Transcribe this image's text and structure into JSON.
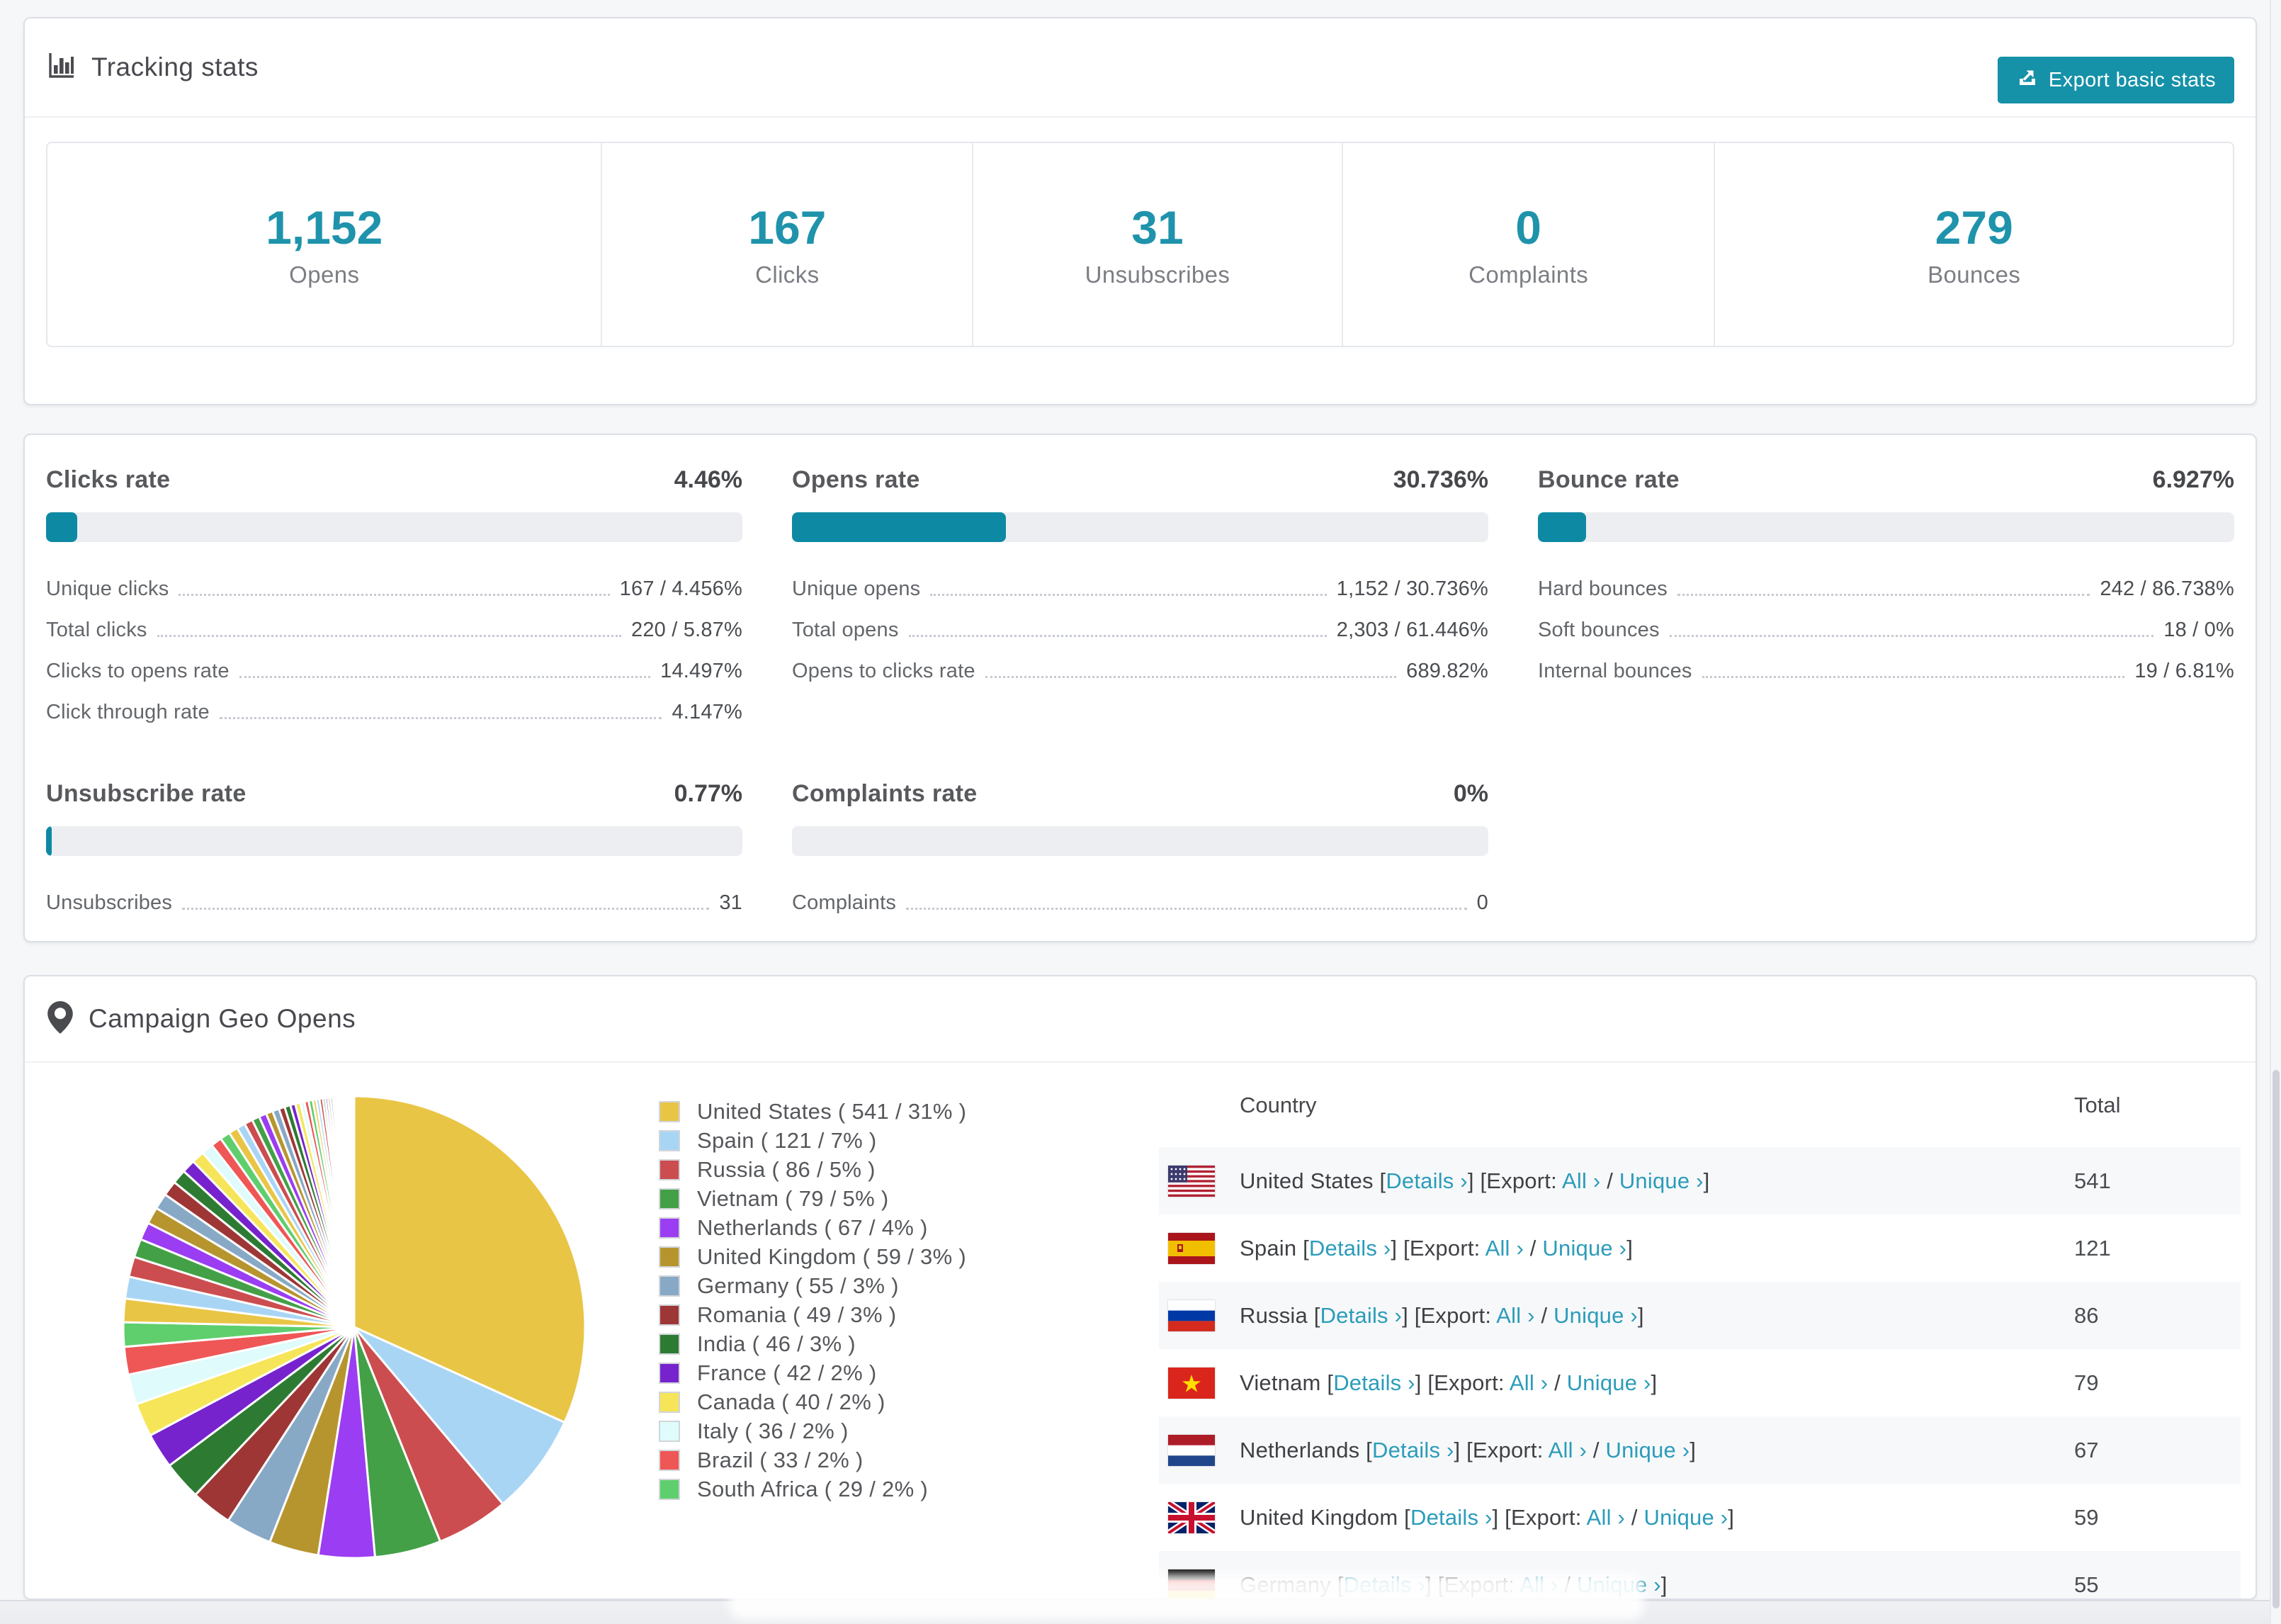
{
  "tracking": {
    "title": "Tracking stats",
    "export_button": "Export basic stats",
    "stats": [
      {
        "value": "1,152",
        "label": "Opens"
      },
      {
        "value": "167",
        "label": "Clicks"
      },
      {
        "value": "31",
        "label": "Unsubscribes"
      },
      {
        "value": "0",
        "label": "Complaints"
      },
      {
        "value": "279",
        "label": "Bounces"
      }
    ]
  },
  "rates": [
    {
      "title": "Clicks rate",
      "value": "4.46%",
      "percent": 4.46,
      "rows": [
        {
          "label": "Unique clicks",
          "value": "167 / 4.456%"
        },
        {
          "label": "Total clicks",
          "value": "220 / 5.87%"
        },
        {
          "label": "Clicks to opens rate",
          "value": "14.497%"
        },
        {
          "label": "Click through rate",
          "value": "4.147%"
        }
      ]
    },
    {
      "title": "Opens rate",
      "value": "30.736%",
      "percent": 30.736,
      "rows": [
        {
          "label": "Unique opens",
          "value": "1,152 / 30.736%"
        },
        {
          "label": "Total opens",
          "value": "2,303 / 61.446%"
        },
        {
          "label": "Opens to clicks rate",
          "value": "689.82%"
        }
      ]
    },
    {
      "title": "Bounce rate",
      "value": "6.927%",
      "percent": 6.927,
      "rows": [
        {
          "label": "Hard bounces",
          "value": "242 / 86.738%"
        },
        {
          "label": "Soft bounces",
          "value": "18 / 0%"
        },
        {
          "label": "Internal bounces",
          "value": "19 / 6.81%"
        }
      ]
    },
    {
      "title": "Unsubscribe rate",
      "value": "0.77%",
      "percent": 0.77,
      "rows": [
        {
          "label": "Unsubscribes",
          "value": "31"
        }
      ]
    },
    {
      "title": "Complaints rate",
      "value": "0%",
      "percent": 0,
      "rows": [
        {
          "label": "Complaints",
          "value": "0"
        }
      ]
    }
  ],
  "geo": {
    "title": "Campaign Geo Opens",
    "chart_data": {
      "type": "pie",
      "title": "Campaign Geo Opens",
      "start_angle_deg": -90,
      "direction": "clockwise",
      "slices": [
        {
          "label": "United States",
          "value": 541,
          "pct": "31%",
          "color": "#e9c545"
        },
        {
          "label": "Spain",
          "value": 121,
          "pct": "7%",
          "color": "#a9d5f5"
        },
        {
          "label": "Russia",
          "value": 86,
          "pct": "5%",
          "color": "#cc4d4f"
        },
        {
          "label": "Vietnam",
          "value": 79,
          "pct": "5%",
          "color": "#43a047"
        },
        {
          "label": "Netherlands",
          "value": 67,
          "pct": "4%",
          "color": "#9b3df2"
        },
        {
          "label": "United Kingdom",
          "value": 59,
          "pct": "3%",
          "color": "#b7952e"
        },
        {
          "label": "Germany",
          "value": 55,
          "pct": "3%",
          "color": "#88a9c6"
        },
        {
          "label": "Romania",
          "value": 49,
          "pct": "3%",
          "color": "#9e3636"
        },
        {
          "label": "India",
          "value": 46,
          "pct": "3%",
          "color": "#2d7b33"
        },
        {
          "label": "France",
          "value": 42,
          "pct": "2%",
          "color": "#7723cd"
        },
        {
          "label": "Canada",
          "value": 40,
          "pct": "2%",
          "color": "#f6e558"
        },
        {
          "label": "Italy",
          "value": 36,
          "pct": "2%",
          "color": "#dffbfb"
        },
        {
          "label": "Brazil",
          "value": 33,
          "pct": "2%",
          "color": "#ef5656"
        },
        {
          "label": "South Africa",
          "value": 29,
          "pct": "2%",
          "color": "#5fce6d"
        }
      ],
      "tail_values": [
        28,
        26,
        24,
        22,
        21,
        20,
        19,
        18,
        17,
        16,
        15,
        14,
        13,
        12,
        11,
        10,
        10,
        9,
        9,
        8,
        8,
        7,
        7,
        6,
        6,
        5,
        5,
        5,
        4,
        4,
        4,
        3,
        3,
        3,
        3,
        2,
        2,
        2,
        2,
        2,
        2,
        1,
        1,
        1,
        1,
        1,
        1,
        1,
        1,
        1,
        1,
        1,
        1,
        1
      ]
    },
    "table": {
      "headers": [
        "Country",
        "Total"
      ],
      "link_labels": {
        "details": "Details ›",
        "export": "Export:",
        "all": "All ›",
        "unique": "Unique ›"
      },
      "rows": [
        {
          "country": "United States",
          "flag": "us",
          "total": "541"
        },
        {
          "country": "Spain",
          "flag": "es",
          "total": "121"
        },
        {
          "country": "Russia",
          "flag": "ru",
          "total": "86"
        },
        {
          "country": "Vietnam",
          "flag": "vn",
          "total": "79"
        },
        {
          "country": "Netherlands",
          "flag": "nl",
          "total": "67"
        },
        {
          "country": "United Kingdom",
          "flag": "gb",
          "total": "59"
        },
        {
          "country": "Germany",
          "flag": "de",
          "total": "55"
        }
      ]
    }
  }
}
